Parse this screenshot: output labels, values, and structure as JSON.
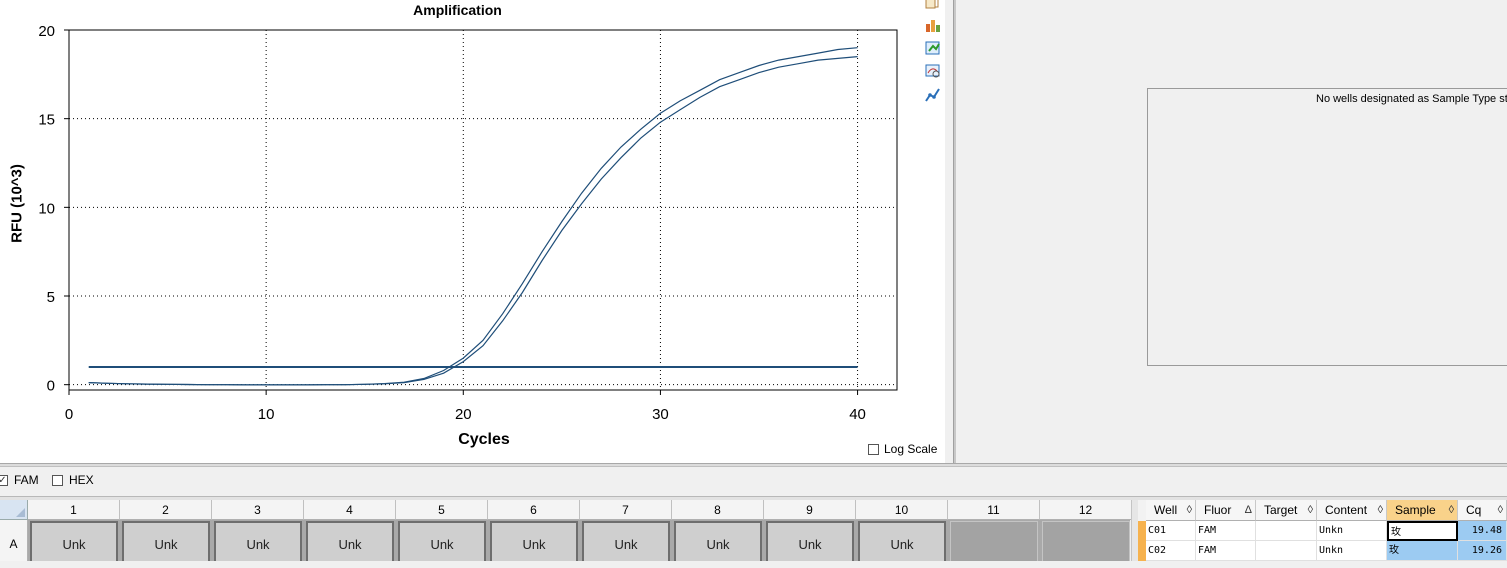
{
  "chart_data": {
    "type": "line",
    "title": "Amplification",
    "xlabel": "Cycles",
    "ylabel": "RFU (10^3)",
    "xlim": [
      0,
      42
    ],
    "ylim": [
      -0.3,
      20
    ],
    "xticks": [
      0,
      10,
      20,
      30,
      40
    ],
    "yticks": [
      0,
      5,
      10,
      15,
      20
    ],
    "grid": true,
    "threshold": 1.0,
    "x": [
      1,
      2,
      3,
      4,
      5,
      6,
      7,
      8,
      9,
      10,
      11,
      12,
      13,
      14,
      15,
      16,
      17,
      18,
      19,
      20,
      21,
      22,
      23,
      24,
      25,
      26,
      27,
      28,
      29,
      30,
      31,
      32,
      33,
      34,
      35,
      36,
      37,
      38,
      39,
      40
    ],
    "series": [
      {
        "values": [
          0.12,
          0.08,
          0.05,
          0.03,
          0.02,
          0.01,
          0.0,
          0.0,
          -0.01,
          -0.01,
          -0.01,
          -0.01,
          0.0,
          0.0,
          0.02,
          0.06,
          0.14,
          0.35,
          0.8,
          1.5,
          2.5,
          4.0,
          5.7,
          7.5,
          9.2,
          10.8,
          12.2,
          13.4,
          14.4,
          15.3,
          16.0,
          16.6,
          17.2,
          17.6,
          18.0,
          18.3,
          18.5,
          18.7,
          18.9,
          19.0
        ],
        "color": "#1f4e79"
      },
      {
        "values": [
          0.12,
          0.08,
          0.05,
          0.03,
          0.02,
          0.01,
          0.0,
          0.0,
          -0.01,
          -0.01,
          -0.01,
          -0.01,
          0.0,
          0.0,
          0.02,
          0.05,
          0.12,
          0.3,
          0.65,
          1.3,
          2.2,
          3.6,
          5.2,
          7.0,
          8.7,
          10.2,
          11.6,
          12.8,
          13.9,
          14.8,
          15.5,
          16.2,
          16.8,
          17.2,
          17.6,
          17.9,
          18.1,
          18.3,
          18.4,
          18.5
        ],
        "color": "#1f4e79"
      }
    ]
  },
  "chart": {
    "log_scale_label": "Log Scale",
    "log_scale_checked": false
  },
  "toolbar_icons": [
    "copy-icon",
    "chart-options-icon",
    "export-icon",
    "zoom-icon",
    "trace-styles-icon"
  ],
  "right_pane": {
    "message": "No wells designated as Sample Type sta"
  },
  "fluors": [
    {
      "label": "FAM",
      "checked": true
    },
    {
      "label": "HEX",
      "checked": false
    }
  ],
  "plate": {
    "columns": [
      "1",
      "2",
      "3",
      "4",
      "5",
      "6",
      "7",
      "8",
      "9",
      "10",
      "11",
      "12"
    ],
    "rows": [
      "A"
    ],
    "wells": [
      "Unk",
      "Unk",
      "Unk",
      "Unk",
      "Unk",
      "Unk",
      "Unk",
      "Unk",
      "Unk",
      "Unk",
      "",
      ""
    ]
  },
  "table": {
    "headers": [
      "Well",
      "Fluor",
      "Target",
      "Content",
      "Sample",
      "Cq"
    ],
    "sort_glyphs": [
      "◊",
      "Δ",
      "◊",
      "◊",
      "◊",
      "◊"
    ],
    "rows": [
      {
        "well": "C01",
        "fluor": "FAM",
        "target": "",
        "content": "Unkn",
        "sample": "玫",
        "cq": "19.48"
      },
      {
        "well": "C02",
        "fluor": "FAM",
        "target": "",
        "content": "Unkn",
        "sample": "玫",
        "cq": "19.26"
      }
    ]
  },
  "colors": {
    "curve": "#1f4e79",
    "threshold": "#1f4e79",
    "selection": "#9ccbf2",
    "sort_header": "#f9d28a"
  }
}
